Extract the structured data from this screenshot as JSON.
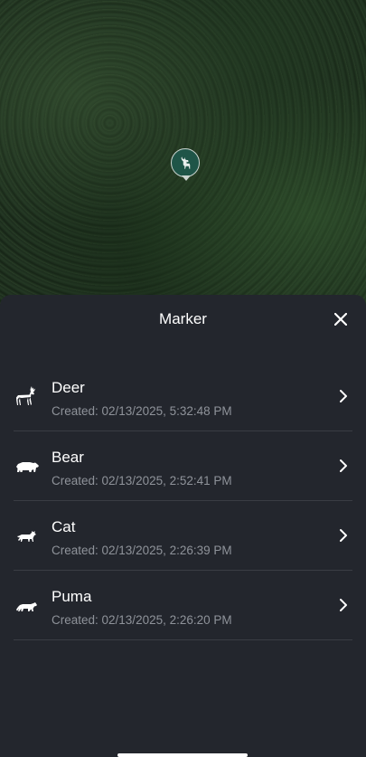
{
  "map": {
    "marker_icon": "deer-icon"
  },
  "sheet": {
    "title": "Marker",
    "close_icon": "close-icon",
    "items": [
      {
        "name": "Deer",
        "created": "Created: 02/13/2025, 5:32:48 PM",
        "icon": "deer-icon"
      },
      {
        "name": "Bear",
        "created": "Created: 02/13/2025, 2:52:41 PM",
        "icon": "bear-icon"
      },
      {
        "name": "Cat",
        "created": "Created: 02/13/2025, 2:26:39 PM",
        "icon": "cat-icon"
      },
      {
        "name": "Puma",
        "created": "Created: 02/13/2025, 2:26:20 PM",
        "icon": "puma-icon"
      }
    ]
  },
  "colors": {
    "sheet_bg": "#23262d",
    "marker_bg": "#1f5548",
    "secondary_text": "#8f939a"
  }
}
